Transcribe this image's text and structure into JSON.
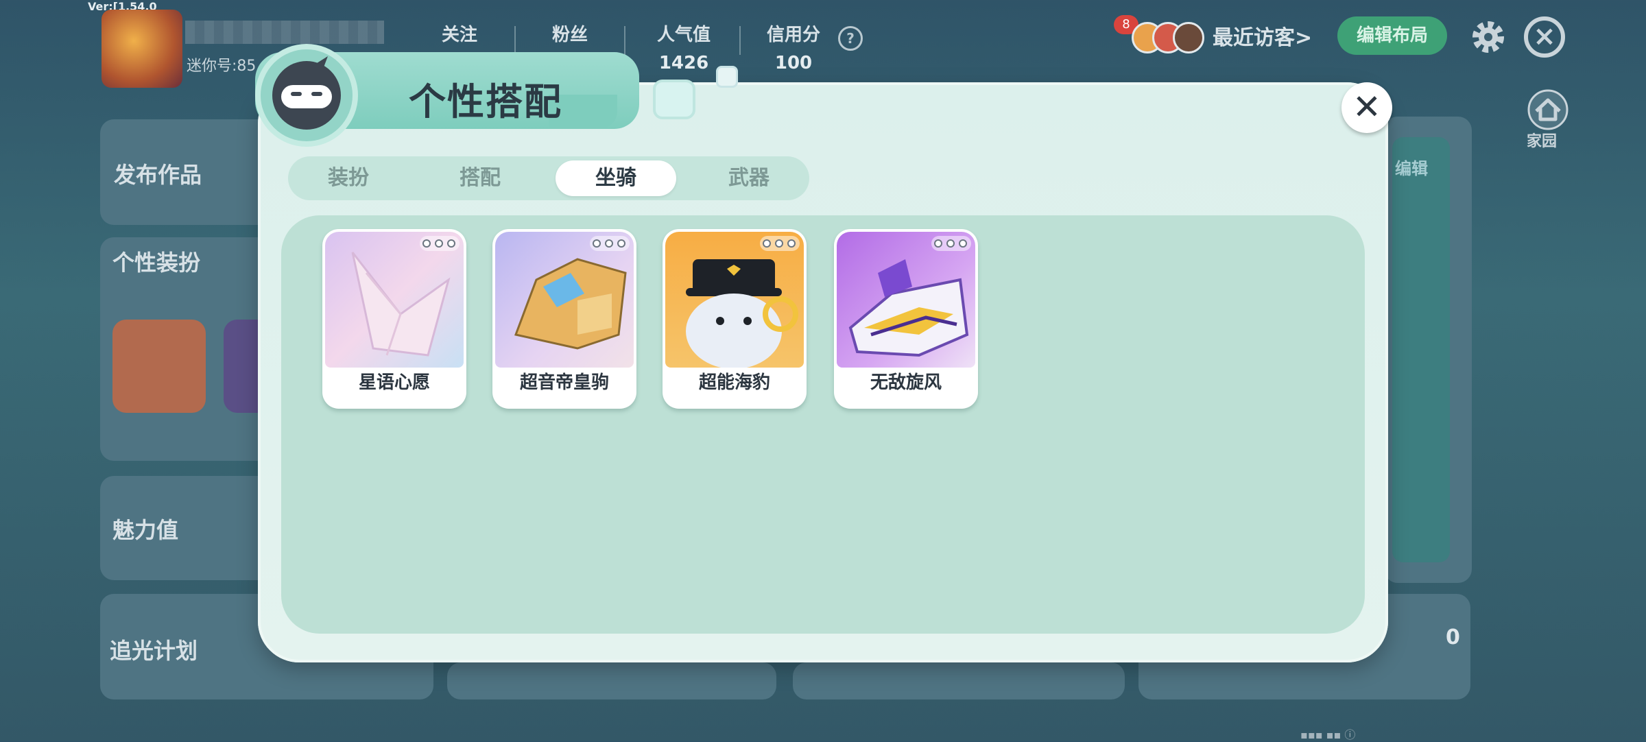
{
  "version": "Ver:[1.54.0",
  "profile": {
    "uid_label": "迷你号:85"
  },
  "stats": [
    {
      "label": "关注",
      "value": ""
    },
    {
      "label": "粉丝",
      "value": ""
    },
    {
      "label": "人气值",
      "value": "1426"
    },
    {
      "label": "信用分",
      "value": "100"
    }
  ],
  "header": {
    "visitor_count": "8",
    "recent_visitors": "最近访客>",
    "edit_layout": "编辑布局",
    "help": "?",
    "home_label": "家园"
  },
  "background_panels": {
    "publish": "发布作品",
    "style": "个性装扮",
    "charm": "魅力值",
    "chase_light": "追光计划",
    "right_edit": "编辑",
    "zero_value": "0"
  },
  "modal": {
    "title": "个性搭配",
    "close": "✕",
    "tabs": [
      {
        "label": "装扮",
        "active": false
      },
      {
        "label": "搭配",
        "active": false
      },
      {
        "label": "坐骑",
        "active": true
      },
      {
        "label": "武器",
        "active": false
      }
    ],
    "mounts": [
      {
        "name": "星语心愿",
        "bg": "#e9c8ee"
      },
      {
        "name": "超音帝皇驹",
        "bg": "#c8c3f4"
      },
      {
        "name": "超能海豹",
        "bg": "#f6b04a"
      },
      {
        "name": "无敌旋风",
        "bg": "#b874e6"
      }
    ]
  },
  "colors": {
    "accent_green": "#3ea176",
    "modal_bg": "#dcf0ec",
    "content_bg": "#bde0d5"
  }
}
